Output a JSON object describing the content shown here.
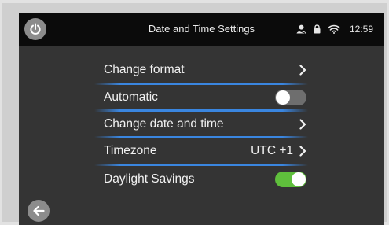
{
  "header": {
    "title": "Date and Time Settings",
    "clock": "12:59",
    "status_icons": [
      "user-icon",
      "lock-icon",
      "wifi-icon"
    ]
  },
  "settings": {
    "change_format": {
      "label": "Change format"
    },
    "automatic": {
      "label": "Automatic",
      "enabled": false
    },
    "change_date_time": {
      "label": "Change date and time"
    },
    "timezone": {
      "label": "Timezone",
      "value": "UTC +1"
    },
    "daylight_savings": {
      "label": "Daylight Savings",
      "enabled": true
    }
  },
  "colors": {
    "separator": "#3a86e0",
    "toggle_on": "#5fbf3c",
    "toggle_off": "#6e6e6e",
    "background": "#343434",
    "topbar": "#0b0b0b"
  }
}
